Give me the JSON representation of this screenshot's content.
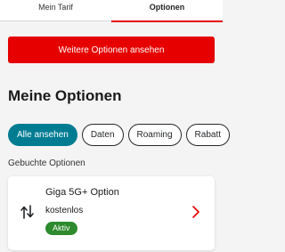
{
  "tabs": [
    {
      "label": "Mein Tarif",
      "active": false
    },
    {
      "label": "Optionen",
      "active": true
    }
  ],
  "cta": {
    "label": "Weitere Optionen ansehen"
  },
  "section_title": "Meine Optionen",
  "filters": [
    {
      "label": "Alle ansehen",
      "active": true
    },
    {
      "label": "Daten",
      "active": false
    },
    {
      "label": "Roaming",
      "active": false
    },
    {
      "label": "Rabatt",
      "active": false
    }
  ],
  "booked_title": "Gebuchte Optionen",
  "option_card": {
    "name": "Giga 5G+ Option",
    "price": "kostenlos",
    "status": "Aktiv",
    "icon": "data-transfer-arrows-icon"
  },
  "colors": {
    "brand_red": "#e60000",
    "filter_active": "#007c92",
    "status_active": "#2d8a2d"
  }
}
